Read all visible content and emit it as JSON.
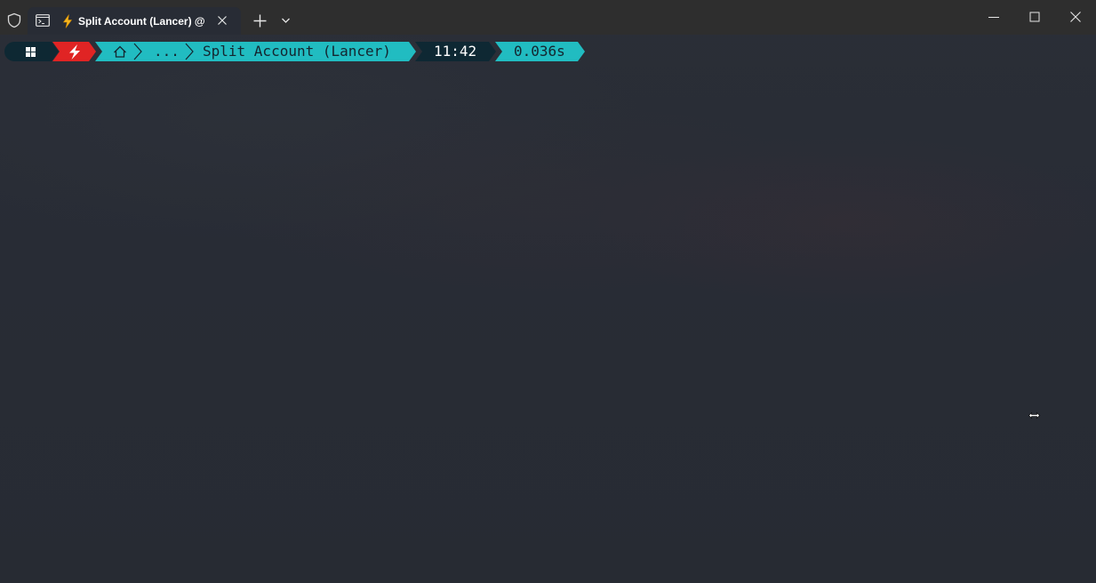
{
  "titlebar": {
    "tab": {
      "icon": "terminal-icon",
      "emoji": "⚡",
      "title": "Split Account (Lancer) @ V"
    },
    "icons": {
      "shield": "shield-icon",
      "close_tab": "close-icon",
      "new_tab": "plus-icon",
      "dropdown": "chevron-down-icon",
      "minimize": "minimize-icon",
      "maximize": "maximize-icon",
      "close_window": "close-icon"
    }
  },
  "prompt": {
    "os_icon": "windows-logo-icon",
    "bolt_icon": "lightning-icon",
    "home_icon": "home-icon",
    "ellipsis": "...",
    "folder": "Split Account (Lancer)",
    "time": "11:42",
    "duration": "0.036s"
  },
  "colors": {
    "background": "#282c35",
    "titlebar": "#2e2e2e",
    "segment_dark": "#0e2833",
    "segment_red": "#e02424",
    "segment_teal": "#21bcc1",
    "text_dark": "#14252f",
    "text_light": "#ffffff"
  },
  "cursor": {
    "type": "horizontal-resize-cursor-icon"
  }
}
